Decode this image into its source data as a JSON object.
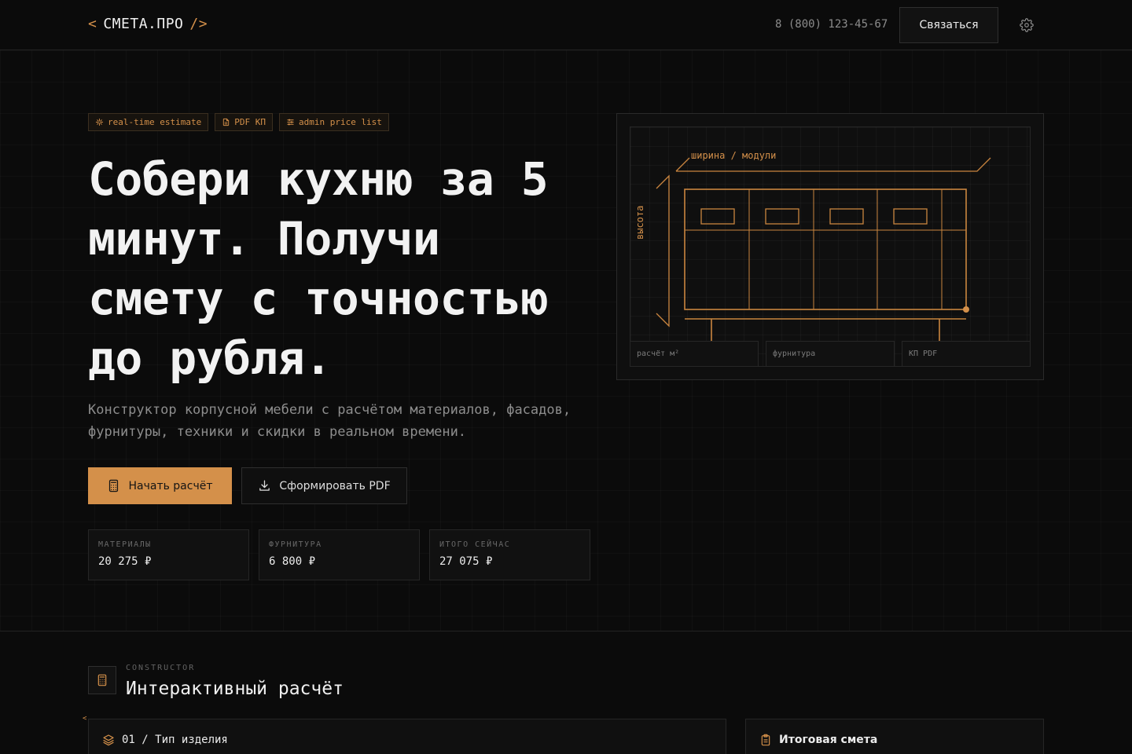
{
  "header": {
    "logo_open": "<",
    "logo_name": "СМЕТА.ПРО",
    "logo_close": "/>",
    "phone": "8 (800) 123-45-67",
    "contact_label": "Связаться"
  },
  "badges": [
    {
      "label": "real-time estimate",
      "icon": "sparkle-icon"
    },
    {
      "label": "PDF КП",
      "icon": "document-icon"
    },
    {
      "label": "admin price list",
      "icon": "sliders-icon"
    }
  ],
  "hero": {
    "title": "Собери кухню за 5 минут. Получи смету с точностью до рубля.",
    "subtitle": "Конструктор корпусной мебели с расчётом материалов, фасадов, фурнитуры, техники и скидки в реальном времени.",
    "primary_label": "Начать расчёт",
    "secondary_label": "Сформировать PDF"
  },
  "stats": [
    {
      "label": "МАТЕРИАЛЫ",
      "value": "20 275 ₽"
    },
    {
      "label": "ФУРНИТУРА",
      "value": "6 800 ₽"
    },
    {
      "label": "ИТОГО СЕЙЧАС",
      "value": "27 075 ₽"
    }
  ],
  "blueprint": {
    "width_label": "ширина / модули",
    "height_label": "высота",
    "cells": [
      "расчёт м²",
      "фурнитура",
      "КП PDF"
    ]
  },
  "section": {
    "eyebrow": "CONSTRUCTOR",
    "title": "Интерактивный расчёт",
    "caret": "<",
    "left_card_title": "01 / Тип изделия",
    "right_card_title": "Итоговая смета"
  },
  "colors": {
    "accent": "#d4904a",
    "background": "#0b0b0b",
    "text": "#ececec"
  }
}
